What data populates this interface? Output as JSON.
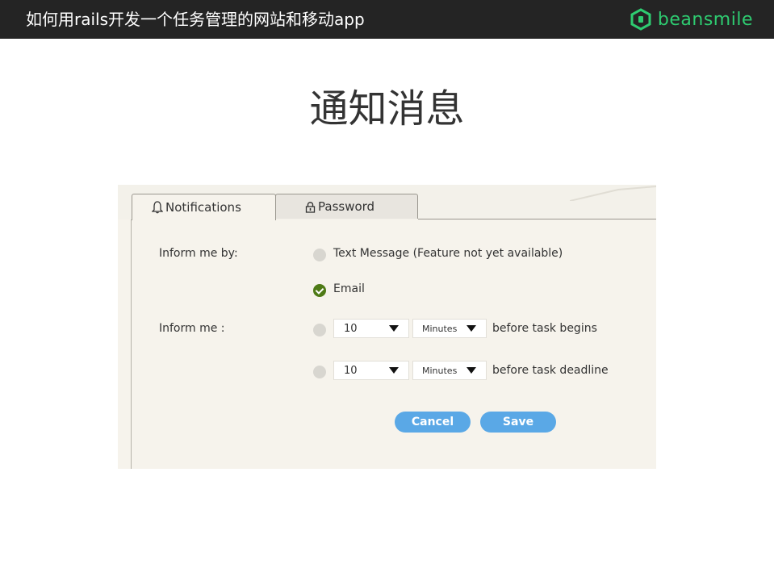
{
  "header": {
    "title": "如何用rails开发一个任务管理的网站和移动app",
    "brand_name": "beansmile",
    "brand_icon": "beansmile-logo-icon",
    "brand_color": "#2ecc71",
    "bar_color": "#242424"
  },
  "slide": {
    "title": "通知消息"
  },
  "settings": {
    "tabs": [
      {
        "label": "Notifications",
        "icon": "bell-icon",
        "active": true
      },
      {
        "label": "Password",
        "icon": "lock-icon",
        "active": false
      }
    ],
    "inform_by_label": "Inform me by:",
    "inform_by_options": [
      {
        "label": "Text Message (Feature not yet available)",
        "checked": false
      },
      {
        "label": "Email",
        "checked": true
      }
    ],
    "inform_me_label": "Inform me :",
    "reminders": [
      {
        "amount": "10",
        "unit": "Minutes",
        "suffix": "before task begins",
        "checked": false
      },
      {
        "amount": "10",
        "unit": "Minutes",
        "suffix": "before task deadline",
        "checked": false
      }
    ],
    "cancel_label": "Cancel",
    "save_label": "Save",
    "accent_color": "#5aa8e6",
    "checked_color": "#4e7a16"
  }
}
